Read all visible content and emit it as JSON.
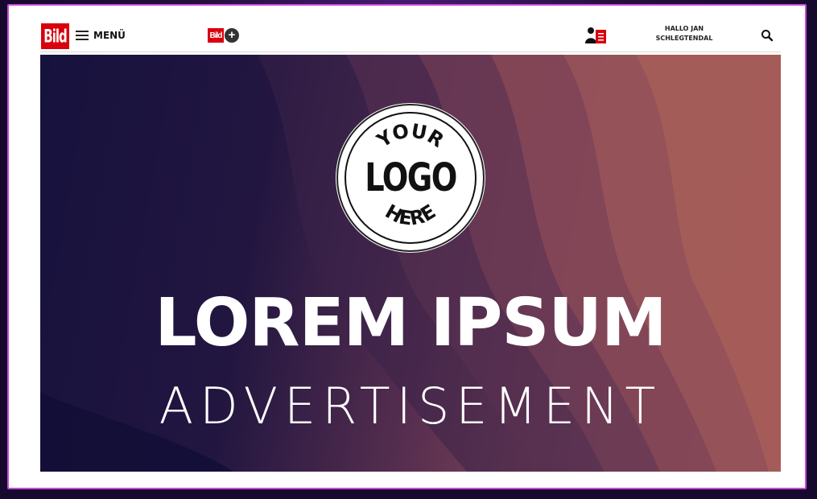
{
  "header": {
    "brand": "Bild",
    "menu_label": "MENÜ",
    "bildplus_brand": "Bild",
    "bildplus_symbol": "+",
    "greeting_line1": "HALLO JAN",
    "greeting_line2": "SCHLEGTENDAL",
    "icons": {
      "menu": "hamburger-icon",
      "account": "account-icon",
      "search": "search-icon"
    }
  },
  "ad": {
    "logo_top": "YOUR",
    "logo_main": "LOGO",
    "logo_bottom": "HERE",
    "headline": "LOREM IPSUM",
    "subline": "ADVERTISEMENT"
  },
  "colors": {
    "brand_red": "#d9000d",
    "frame_border": "#c84ad8",
    "ad_dark": "#16123e",
    "ad_warm": "#bd6a5a"
  }
}
